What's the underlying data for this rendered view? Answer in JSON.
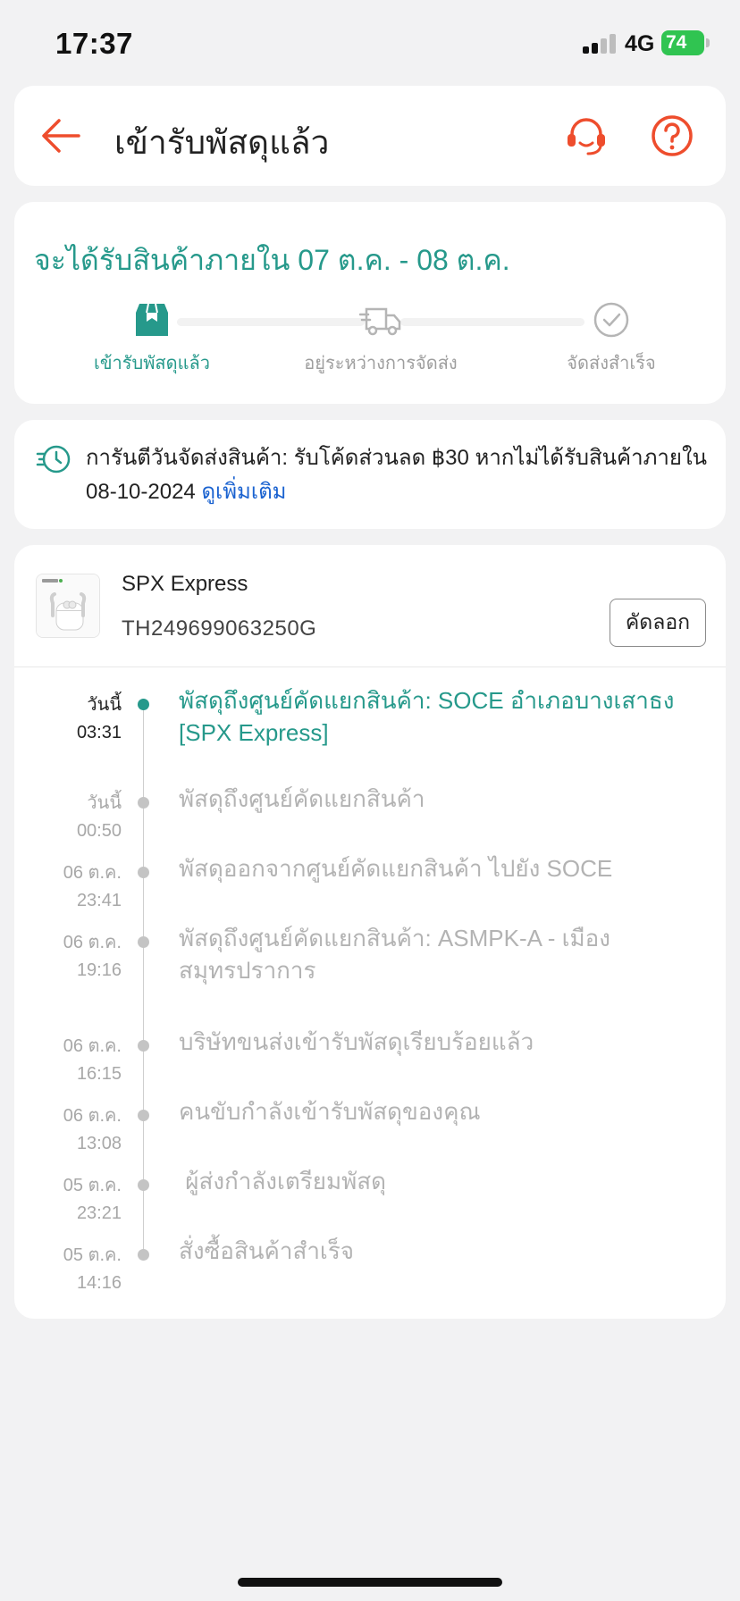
{
  "status_bar": {
    "time": "17:37",
    "network": "4G",
    "battery": "74"
  },
  "header": {
    "title": "เข้ารับพัสดุแล้ว"
  },
  "delivery": {
    "eta": "จะได้รับสินค้าภายใน 07 ต.ค. - 08 ต.ค.",
    "steps": [
      {
        "label": "เข้ารับพัสดุแล้ว"
      },
      {
        "label": "อยู่ระหว่างการจัดส่ง"
      },
      {
        "label": "จัดส่งสำเร็จ"
      }
    ]
  },
  "guarantee": {
    "text": "การันตีวันจัดส่งสินค้า: รับโค้ดส่วนลด ฿30 หากไม่ได้รับสินค้าภายใน 08-10-2024",
    "link": "ดูเพิ่มเติม"
  },
  "shipment": {
    "carrier": "SPX Express",
    "tracking_number": "TH249699063250G",
    "copy_label": "คัดลอก",
    "events": [
      {
        "date": "วันนี้",
        "time": "03:31",
        "text": "พัสดุถึงศูนย์คัดแยกสินค้า: SOCE อำเภอบางเสาธง [SPX Express]"
      },
      {
        "date": "วันนี้",
        "time": "00:50",
        "text": "พัสดุถึงศูนย์คัดแยกสินค้า"
      },
      {
        "date": "06 ต.ค.",
        "time": "23:41",
        "text": "พัสดุออกจากศูนย์คัดแยกสินค้า ไปยัง SOCE"
      },
      {
        "date": "06 ต.ค.",
        "time": "19:16",
        "text": "พัสดุถึงศูนย์คัดแยกสินค้า: ASMPK-A - เมืองสมุทรปราการ"
      },
      {
        "date": "06 ต.ค.",
        "time": "16:15",
        "text": "บริษัทขนส่งเข้ารับพัสดุเรียบร้อยแล้ว"
      },
      {
        "date": "06 ต.ค.",
        "time": "13:08",
        "text": "คนขับกำลังเข้ารับพัสดุของคุณ"
      },
      {
        "date": "05 ต.ค.",
        "time": "23:21",
        "text": " ผู้ส่งกำลังเตรียมพัสดุ"
      },
      {
        "date": "05 ต.ค.",
        "time": "14:16",
        "text": "สั่งซื้อสินค้าสำเร็จ"
      }
    ]
  },
  "colors": {
    "accent": "#26998b",
    "brand_orange": "#ee4d2d",
    "link": "#1a62d0"
  },
  "icons": [
    "back-arrow-icon",
    "headset-icon",
    "help-icon",
    "package-icon",
    "truck-icon",
    "check-circle-icon",
    "guarantee-clock-icon",
    "product-thumbnail"
  ]
}
